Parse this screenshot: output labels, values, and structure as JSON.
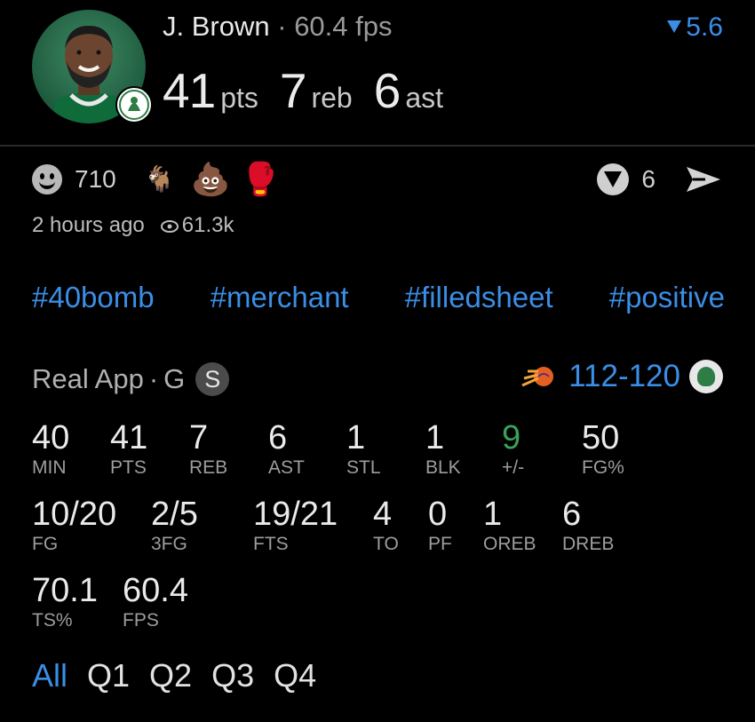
{
  "player": {
    "name": "J. Brown",
    "separator": "·",
    "fps_text": "60.4 fps",
    "pts_value": "41",
    "pts_unit": "pts",
    "reb_value": "7",
    "reb_unit": "reb",
    "ast_value": "6",
    "ast_unit": "ast",
    "delta": "5.6",
    "avatar_icon": "player-headshot",
    "team_icon": "celtics-logo"
  },
  "reactions": {
    "count": "710",
    "emojis": [
      "🐐",
      "💩",
      "🥊"
    ],
    "comments": "6",
    "time_ago": "2 hours ago",
    "views": "61.3k"
  },
  "hashtags": [
    "#40bomb",
    "#merchant",
    "#filledsheet",
    "#positive"
  ],
  "game": {
    "source": "Real App",
    "position": "G",
    "badge": "S",
    "score": "112-120",
    "opponent_icon": "suns-logo",
    "team_icon": "celtics-logo"
  },
  "stats_row1": [
    {
      "value": "40",
      "label": "MIN"
    },
    {
      "value": "41",
      "label": "PTS"
    },
    {
      "value": "7",
      "label": "REB"
    },
    {
      "value": "6",
      "label": "AST"
    },
    {
      "value": "1",
      "label": "STL"
    },
    {
      "value": "1",
      "label": "BLK"
    },
    {
      "value": "9",
      "label": "+/-"
    },
    {
      "value": "50",
      "label": "FG%"
    }
  ],
  "stats_row2": [
    {
      "value": "10/20",
      "label": "FG"
    },
    {
      "value": "2/5",
      "label": "3FG"
    },
    {
      "value": "19/21",
      "label": "FTS"
    },
    {
      "value": "4",
      "label": "TO"
    },
    {
      "value": "0",
      "label": "PF"
    },
    {
      "value": "1",
      "label": "OREB"
    },
    {
      "value": "6",
      "label": "DREB"
    }
  ],
  "stats_row3": [
    {
      "value": "70.1",
      "label": "TS%"
    },
    {
      "value": "60.4",
      "label": "FPS"
    }
  ],
  "tabs": [
    "All",
    "Q1",
    "Q2",
    "Q3",
    "Q4"
  ],
  "colors": {
    "accent": "#3a8ee6",
    "positive": "#3aa05a",
    "background": "#000000"
  }
}
